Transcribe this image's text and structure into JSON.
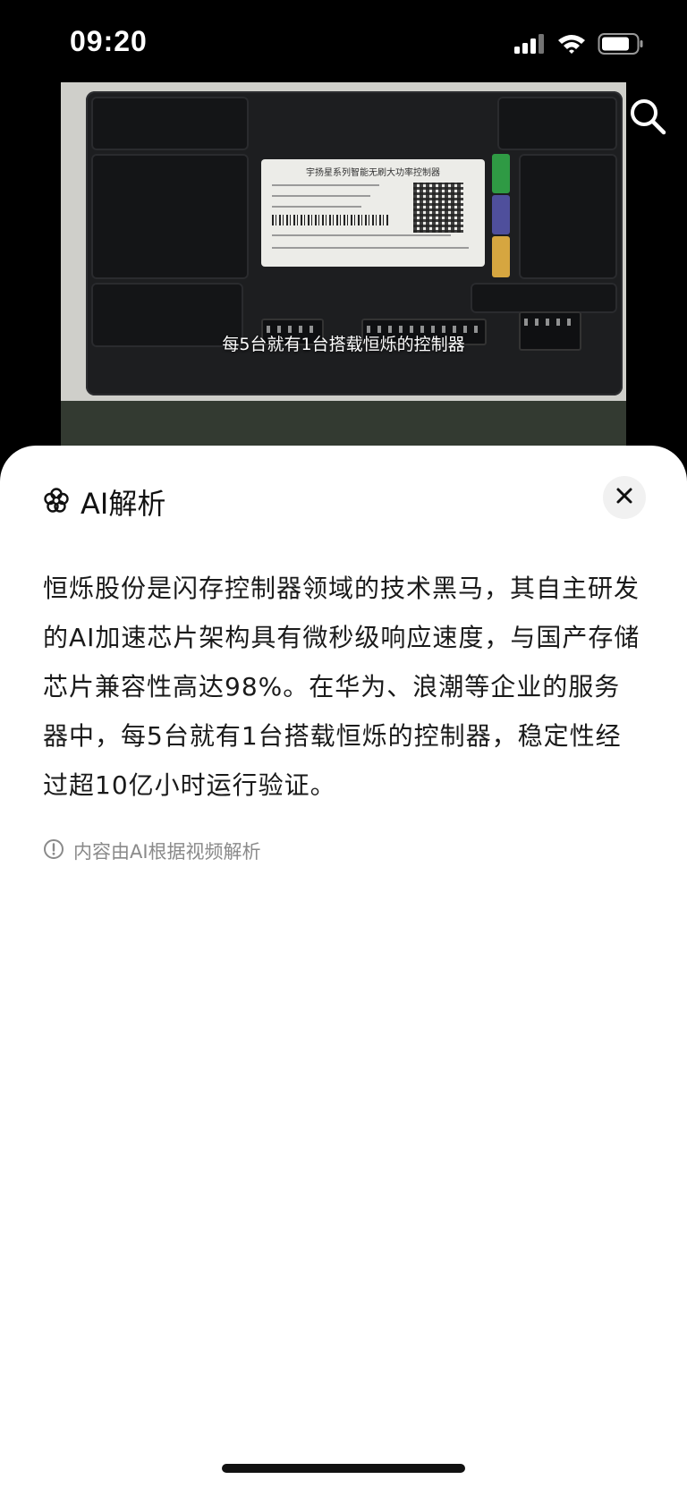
{
  "status_bar": {
    "time": "09:20"
  },
  "video": {
    "caption": "每5台就有1台搭载恒烁的控制器",
    "label_title": "宇扬星系列智能无刷大功率控制器"
  },
  "sheet": {
    "title": "AI解析",
    "body": "恒烁股份是闪存控制器领域的技术黑马，其自主研发的AI加速芯片架构具有微秒级响应速度，与国产存储芯片兼容性高达98%。在华为、浪潮等企业的服务器中，每5台就有1台搭载恒烁的控制器，稳定性经过超10亿小时运行验证。",
    "disclaimer": "内容由AI根据视频解析"
  },
  "icons": {
    "status": [
      "cellular-signal-icon",
      "wifi-icon",
      "battery-icon"
    ],
    "search": "search-icon",
    "ai": "ai-flower-icon",
    "close": "close-icon",
    "info": "info-circle-icon"
  },
  "colors": {
    "strip_green": "#2f9a44",
    "strip_blue": "#4f4f9c",
    "strip_yellow": "#d6a640",
    "video_bottom": "#333a31"
  }
}
